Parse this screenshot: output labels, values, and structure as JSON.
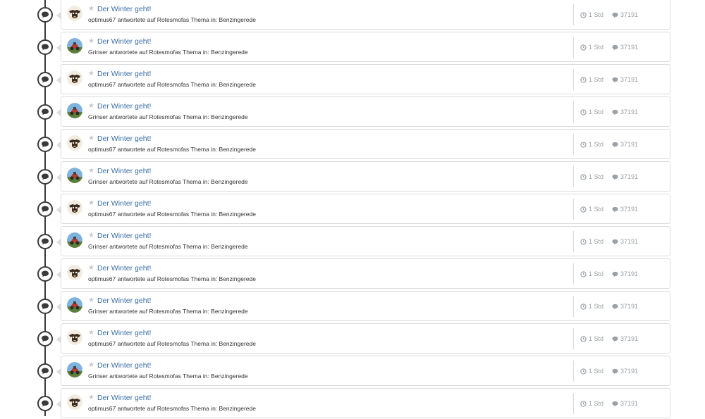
{
  "feed": {
    "items": [
      {
        "title": "Der Winter geht!",
        "subtitle": "optimus67 antwortete auf Rotesmofas Thema in: Benzingerede",
        "time": "1 Std",
        "replies": "37191",
        "avatar": "avatar-optimus67"
      },
      {
        "title": "Der Winter geht!",
        "subtitle": "Grinser antwortete auf Rotesmofas Thema in: Benzingerede",
        "time": "1 Std",
        "replies": "37191",
        "avatar": "avatar-grinser"
      },
      {
        "title": "Der Winter geht!",
        "subtitle": "optimus67 antwortete auf Rotesmofas Thema in: Benzingerede",
        "time": "1 Std",
        "replies": "37191",
        "avatar": "avatar-optimus67"
      },
      {
        "title": "Der Winter geht!",
        "subtitle": "Grinser antwortete auf Rotesmofas Thema in: Benzingerede",
        "time": "1 Std",
        "replies": "37191",
        "avatar": "avatar-grinser"
      },
      {
        "title": "Der Winter geht!",
        "subtitle": "optimus67 antwortete auf Rotesmofas Thema in: Benzingerede",
        "time": "1 Std",
        "replies": "37191",
        "avatar": "avatar-optimus67"
      },
      {
        "title": "Der Winter geht!",
        "subtitle": "Grinser antwortete auf Rotesmofas Thema in: Benzingerede",
        "time": "1 Std",
        "replies": "37191",
        "avatar": "avatar-grinser"
      },
      {
        "title": "Der Winter geht!",
        "subtitle": "optimus67 antwortete auf Rotesmofas Thema in: Benzingerede",
        "time": "1 Std",
        "replies": "37191",
        "avatar": "avatar-optimus67"
      },
      {
        "title": "Der Winter geht!",
        "subtitle": "Grinser antwortete auf Rotesmofas Thema in: Benzingerede",
        "time": "1 Std",
        "replies": "37191",
        "avatar": "avatar-grinser"
      },
      {
        "title": "Der Winter geht!",
        "subtitle": "optimus67 antwortete auf Rotesmofas Thema in: Benzingerede",
        "time": "1 Std",
        "replies": "37191",
        "avatar": "avatar-optimus67"
      },
      {
        "title": "Der Winter geht!",
        "subtitle": "Grinser antwortete auf Rotesmofas Thema in: Benzingerede",
        "time": "1 Std",
        "replies": "37191",
        "avatar": "avatar-grinser"
      },
      {
        "title": "Der Winter geht!",
        "subtitle": "optimus67 antwortete auf Rotesmofas Thema in: Benzingerede",
        "time": "1 Std",
        "replies": "37191",
        "avatar": "avatar-optimus67"
      },
      {
        "title": "Der Winter geht!",
        "subtitle": "Grinser antwortete auf Rotesmofas Thema in: Benzingerede",
        "time": "1 Std",
        "replies": "37191",
        "avatar": "avatar-grinser"
      },
      {
        "title": "Der Winter geht!",
        "subtitle": "optimus67 antwortete auf Rotesmofas Thema in: Benzingerede",
        "time": "1 Std",
        "replies": "37191",
        "avatar": "avatar-optimus67"
      }
    ]
  },
  "icons": {
    "timeline_node": "speech-bubble-icon",
    "favorite": "star-icon",
    "time": "clock-icon",
    "replies": "comment-icon"
  },
  "colors": {
    "link": "#3a6ea5",
    "meta": "#9aa0a6",
    "border": "#dcdcdc",
    "timeline": "#3a3a3a"
  }
}
